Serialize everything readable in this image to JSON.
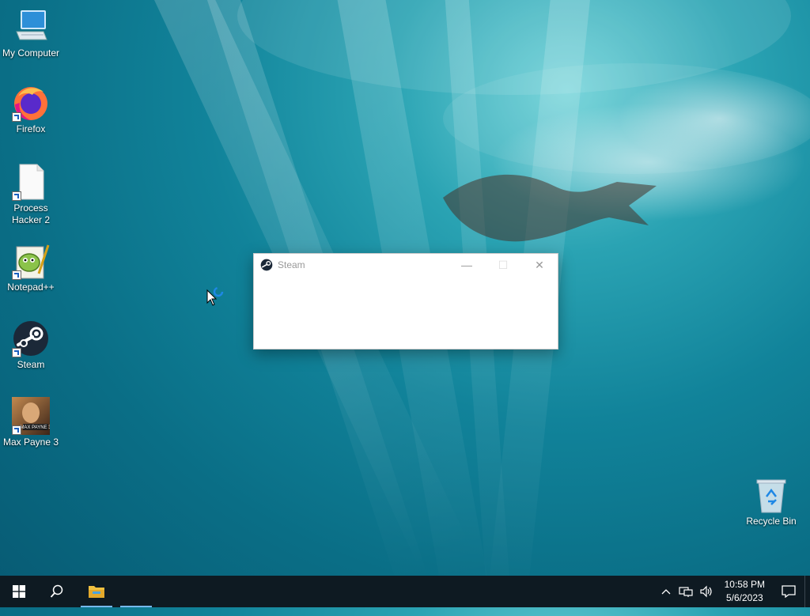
{
  "desktop": {
    "icons": [
      {
        "label": "My Computer",
        "icon": "computer-icon"
      },
      {
        "label": "Firefox",
        "icon": "firefox-icon"
      },
      {
        "label": "Process Hacker 2",
        "icon": "document-icon"
      },
      {
        "label": "Notepad++",
        "icon": "notepadpp-icon"
      },
      {
        "label": "Steam",
        "icon": "steam-icon"
      },
      {
        "label": "Max Payne 3",
        "icon": "maxpayne3-icon"
      },
      {
        "label": "Recycle Bin",
        "icon": "recycle-bin-icon"
      }
    ]
  },
  "window": {
    "title": "Steam",
    "minimize": "—",
    "maximize": "☐",
    "close": "✕"
  },
  "taskbar": {
    "start_icon": "windows-logo-icon",
    "search_icon": "search-icon",
    "explorer_icon": "file-explorer-icon",
    "tray_chevron": "^",
    "time": "10:58 PM",
    "date": "5/6/2023"
  },
  "colors": {
    "taskbar": "#0e1a22",
    "accent": "#76b9ed",
    "steam_blue": "#1b2838"
  }
}
